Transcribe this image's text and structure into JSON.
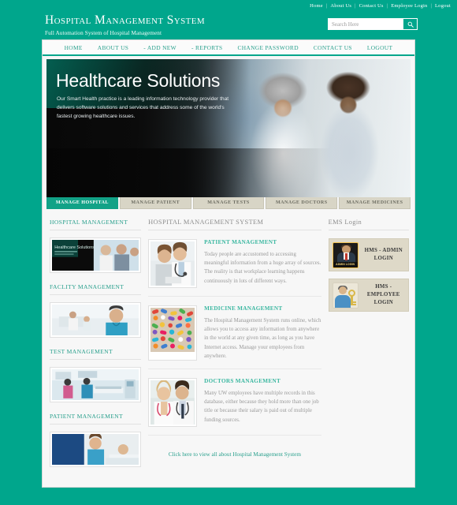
{
  "top_links": [
    {
      "label": "Home"
    },
    {
      "label": "About Us"
    },
    {
      "label": "Contact Us"
    },
    {
      "label": "Employee Login"
    },
    {
      "label": "Logout"
    }
  ],
  "separator": "|",
  "brand": {
    "title": "Hospital Management System",
    "tagline": "Full Automation System of Hospital Management"
  },
  "search": {
    "placeholder": "Search Here",
    "value": "",
    "icon": "search-icon"
  },
  "nav": [
    {
      "label": "HOME"
    },
    {
      "label": "ABOUT US"
    },
    {
      "label": "- ADD NEW"
    },
    {
      "label": "- REPORTS"
    },
    {
      "label": "CHANGE PASSWORD"
    },
    {
      "label": "CONTACT US"
    },
    {
      "label": "LOGOUT"
    }
  ],
  "banner": {
    "headline": "Healthcare Solutions",
    "subtext": "Our Smart Health practice is a leading information technology provider that delivers software solutions and services that address some of the world's fastest growing healthcare issues."
  },
  "tabs": [
    {
      "label": "MANAGE HOSPITAL",
      "active": true
    },
    {
      "label": "MANAGE PATIENT",
      "active": false
    },
    {
      "label": "MANAGE TESTS",
      "active": false
    },
    {
      "label": "MANAGE DOCTORS",
      "active": false
    },
    {
      "label": "MANAGE MEDICINES",
      "active": false
    }
  ],
  "sidebar": {
    "sections": [
      {
        "title": "HOSPITAL MANAGEMENT",
        "image": "healthcare-banner-thumbnail"
      },
      {
        "title": "FACLITY MANAGEMENT",
        "image": "nurse-facility-thumbnail"
      },
      {
        "title": "TEST MANAGEMENT",
        "image": "operating-room-thumbnail"
      },
      {
        "title": "PATIENT MANAGEMENT",
        "image": "patient-care-thumbnail"
      }
    ]
  },
  "main": {
    "heading": "HOSPITAL MANAGEMENT SYSTEM",
    "articles": [
      {
        "title": "PATIENT MANAGEMENT",
        "text": "Today people are accustomed to accessing meaningful information from a huge array of sources. The reality is that workplace learning happens continuously in lots of different ways.",
        "image": "doctor-and-patient-thumbnail"
      },
      {
        "title": "MEDICINE MANAGEMENT",
        "text": "The Hospital Management System runs online, which allows you to access any information from anywhere in the world at any given time, as long as you have Internet access. Manage your employees from anywhere.",
        "image": "colorful-pills-thumbnail"
      },
      {
        "title": "DOCTORS MANAGEMENT",
        "text": "Many UW employees have multiple records in this database, either because they hold more than one job title or because their salary is paid out of multiple funding sources.",
        "image": "two-doctors-thumbnail"
      }
    ],
    "view_all_link": "Click here to view all about Hospital Management System"
  },
  "right_panel": {
    "heading": "EMS Login",
    "cards": [
      {
        "label": "HMS - ADMIN LOGIN",
        "icon": "admin-login-icon",
        "badge_text": "ADMIN LOGIN"
      },
      {
        "label": "HMS - EMPLOYEE LOGIN",
        "icon": "employee-key-icon",
        "badge_text": ""
      }
    ]
  },
  "colors": {
    "brand_teal": "#00a68c",
    "accent_teal": "#2aa08d",
    "panel_bg": "#f7f7f7",
    "tab_inactive": "#d8d5c6",
    "card_bg": "#ded9c8"
  }
}
